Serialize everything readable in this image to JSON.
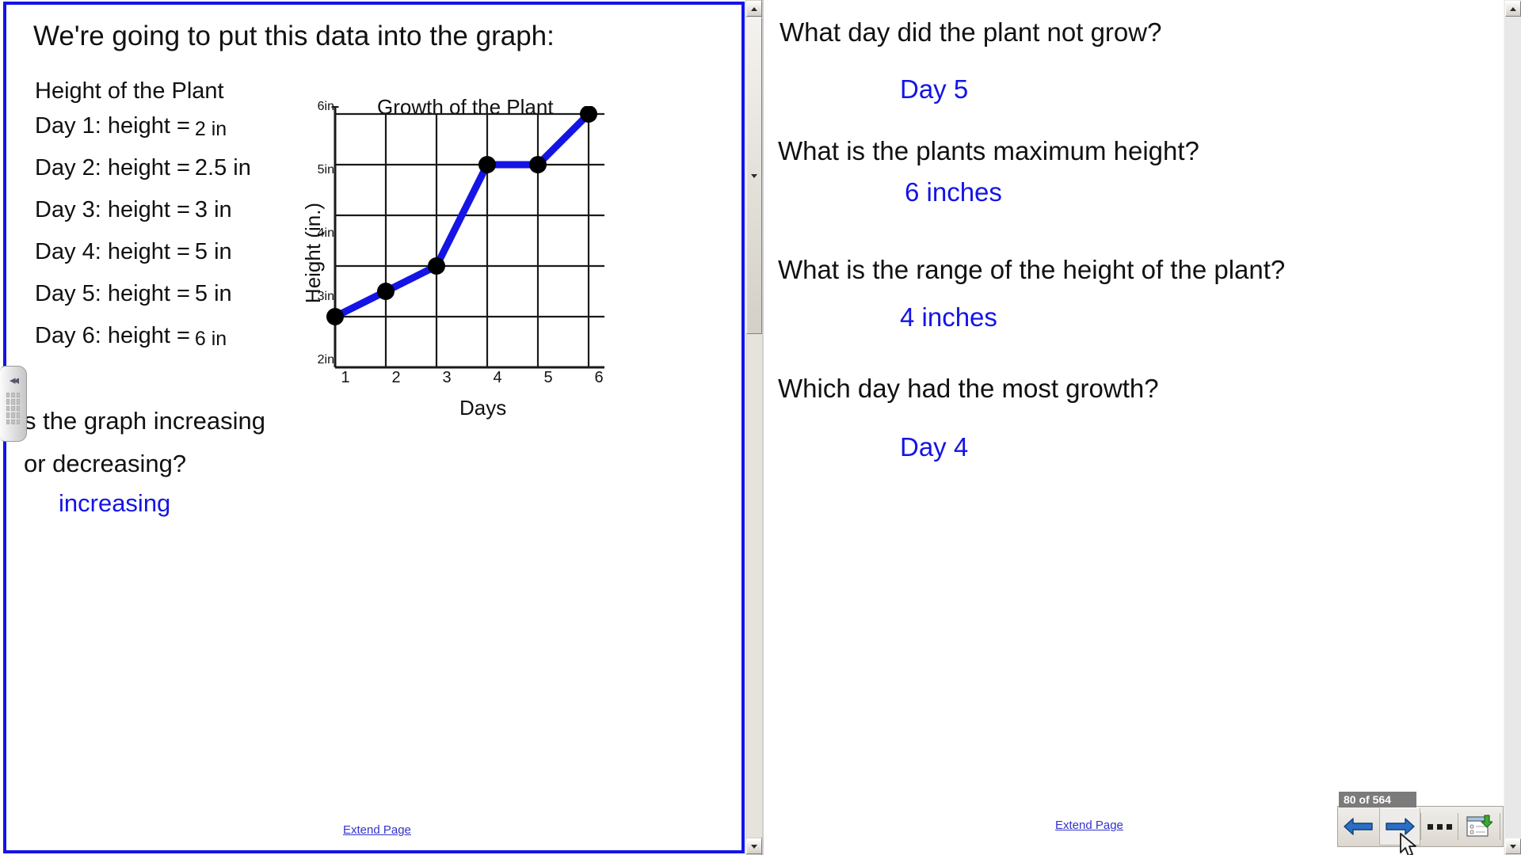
{
  "left_page": {
    "heading": "We're going to put this data into the graph:",
    "subheading": "Height of the Plant",
    "data_rows": [
      {
        "label": "Day 1: height =",
        "value": "2 in",
        "style": "small"
      },
      {
        "label": "Day 2: height =",
        "value": "2.5 in",
        "style": "norm"
      },
      {
        "label": "Day 3: height =",
        "value": "3 in",
        "style": "norm"
      },
      {
        "label": "Day 4: height =",
        "value": "5 in",
        "style": "norm"
      },
      {
        "label": "Day 5: height =",
        "value": "5 in",
        "style": "norm"
      },
      {
        "label": "Day 6: height =",
        "value": "6 in",
        "style": "small"
      }
    ],
    "question_line1": "s the graph increasing",
    "question_line2": "or decreasing?",
    "answer": "increasing",
    "extend_link": "Extend Page"
  },
  "right_page": {
    "qa": [
      {
        "question": "What day did the plant not grow?",
        "answer": "Day 5"
      },
      {
        "question": "What is the plants maximum height?",
        "answer": "6 inches"
      },
      {
        "question": "What is the range of the height of the plant?",
        "answer": "4 inches"
      },
      {
        "question": "Which day had the most growth?",
        "answer": "Day 4"
      }
    ],
    "extend_link": "Extend Page"
  },
  "chart_data": {
    "type": "line",
    "title": "Growth of the Plant",
    "xlabel": "Days",
    "ylabel": "Height (in.)",
    "x": [
      1,
      2,
      3,
      4,
      5,
      6
    ],
    "xtick_labels": [
      "1",
      "2",
      "3",
      "4",
      "5",
      "6"
    ],
    "values": [
      2,
      2.5,
      3,
      5,
      5,
      6
    ],
    "ytick_labels": [
      "6in",
      "5in",
      "4in",
      "3in",
      "2in"
    ],
    "ytick_values": [
      6,
      5,
      4,
      3,
      2
    ],
    "ylim": [
      1,
      6
    ],
    "xlim": [
      1,
      6
    ],
    "grid": true,
    "legend": "none",
    "series_color": "#1414e6",
    "marker_color": "#000000"
  },
  "toolbar": {
    "page_counter": "80 of 564",
    "previous_label": "previous-page",
    "next_label": "next-page",
    "more_label": "more-options",
    "export_label": "export-page"
  },
  "colors": {
    "selection_border": "#1414e6",
    "answer_text": "#1414e6",
    "link": "#3333cc",
    "counter_bg": "#7b7b7b"
  }
}
